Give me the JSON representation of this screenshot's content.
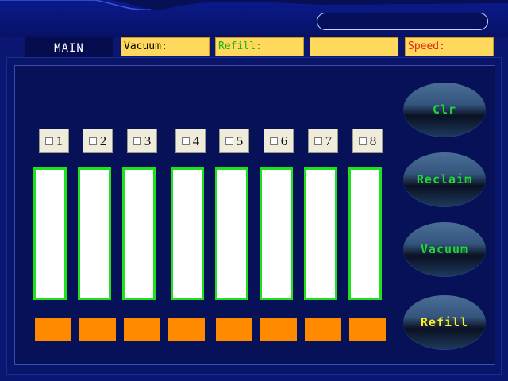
{
  "tab": {
    "main_label": "MAIN"
  },
  "fields": [
    {
      "label": "Vacuum:",
      "color": "#000000"
    },
    {
      "label": "Refill:",
      "color": "#1db31d"
    },
    {
      "label": "",
      "color": "#000000"
    },
    {
      "label": "Speed:",
      "color": "#e0201a"
    }
  ],
  "channels": [
    {
      "label": "1"
    },
    {
      "label": "2"
    },
    {
      "label": "3"
    },
    {
      "label": "4"
    },
    {
      "label": "5"
    },
    {
      "label": "6"
    },
    {
      "label": "7"
    },
    {
      "label": "8"
    }
  ],
  "buttons": {
    "clr": "Clr",
    "reclaim": "Reclaim",
    "vacuum": "Vacuum",
    "refill": "Refill"
  },
  "colors": {
    "background": "#0a1670",
    "field_fill": "#ffd85c",
    "chamber_border": "#1ee21e",
    "indicator": "#ff8a00",
    "button_text": "#22d633",
    "refill_button_text": "#ffee22"
  }
}
